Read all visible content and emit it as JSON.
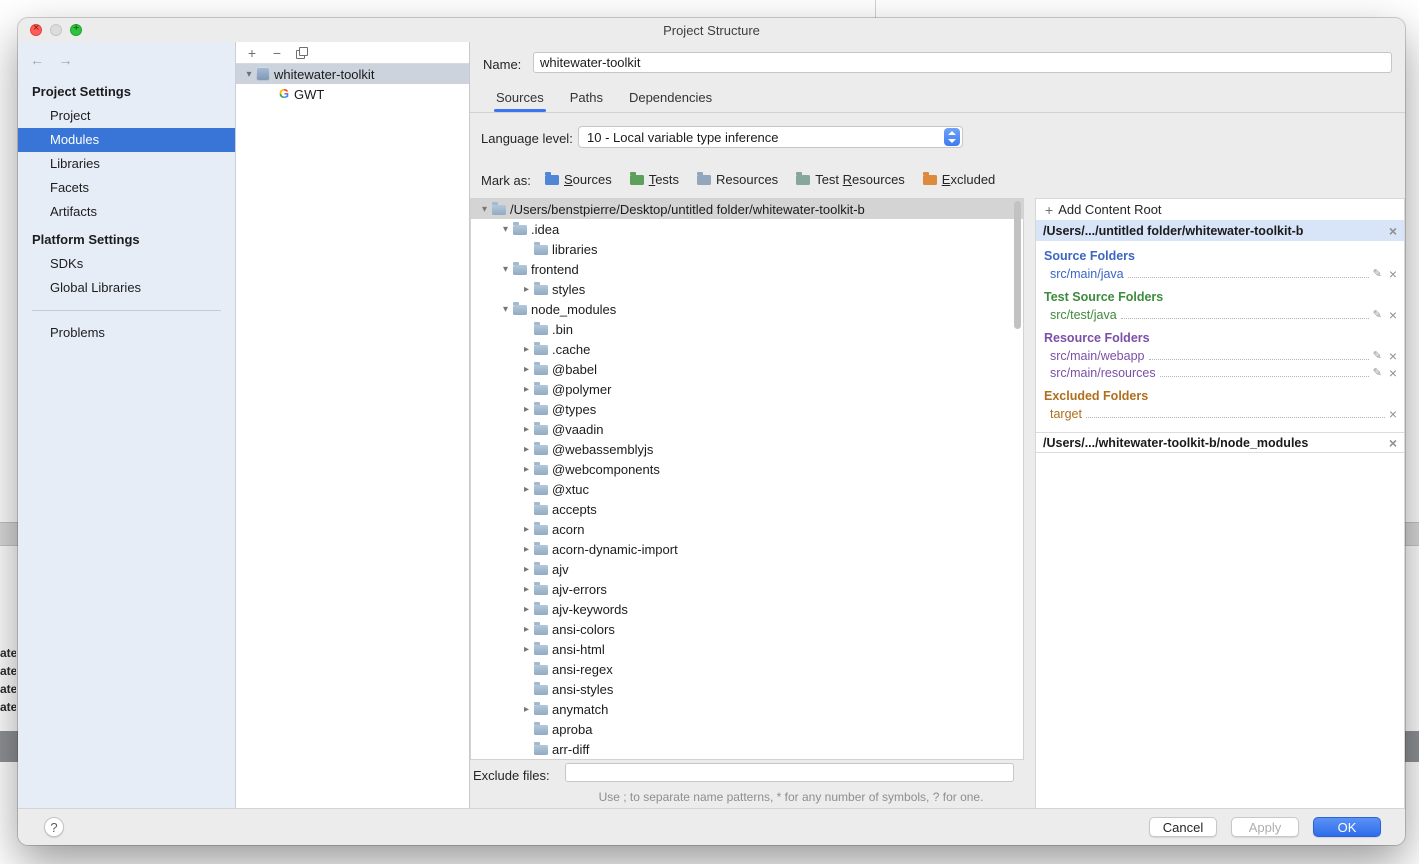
{
  "window": {
    "title": "Project Structure"
  },
  "background_fragments": [
    "ate",
    "ate",
    "ate",
    "ate"
  ],
  "colors": {
    "sidebar_selection": "#3875d7",
    "tab_accent": "#3b76f2",
    "ok_button": "#3b76f2"
  },
  "sidebar": {
    "groups": [
      {
        "header": "Project Settings",
        "items": [
          {
            "label": "Project",
            "selected": false
          },
          {
            "label": "Modules",
            "selected": true
          },
          {
            "label": "Libraries",
            "selected": false
          },
          {
            "label": "Facets",
            "selected": false
          },
          {
            "label": "Artifacts",
            "selected": false
          }
        ]
      },
      {
        "header": "Platform Settings",
        "items": [
          {
            "label": "SDKs",
            "selected": false
          },
          {
            "label": "Global Libraries",
            "selected": false
          }
        ]
      }
    ],
    "problems_label": "Problems"
  },
  "module_panel": {
    "module_name": "whitewater-toolkit",
    "facet_name": "GWT"
  },
  "main": {
    "name_label": "Name:",
    "name_value": "whitewater-toolkit",
    "tabs": [
      {
        "label": "Sources",
        "selected": true
      },
      {
        "label": "Paths",
        "selected": false
      },
      {
        "label": "Dependencies",
        "selected": false
      }
    ],
    "language_level_label": "Language level:",
    "language_level_value": "10 - Local variable type inference",
    "mark_as_label": "Mark as:",
    "mark_buttons": [
      {
        "label": "Sources",
        "underline": 0,
        "color": "#4f87d6"
      },
      {
        "label": "Tests",
        "underline": 0,
        "color": "#5ca05c"
      },
      {
        "label": "Resources",
        "underline": null,
        "color": "#93a7bc"
      },
      {
        "label": "Test Resources",
        "underline": 5,
        "color": "#86a79a"
      },
      {
        "label": "Excluded",
        "underline": 0,
        "color": "#de8a3e"
      }
    ],
    "exclude_label": "Exclude files:",
    "exclude_value": "",
    "exclude_hint": "Use ; to separate name patterns, * for any number of symbols, ? for one."
  },
  "file_tree": {
    "rows": [
      {
        "label": "/Users/benstpierre/Desktop/untitled folder/whitewater-toolkit-b",
        "level": 0,
        "expand": "open",
        "selected": true
      },
      {
        "label": ".idea",
        "level": 1,
        "expand": "open",
        "selected": false
      },
      {
        "label": "libraries",
        "level": 2,
        "expand": "none",
        "selected": false
      },
      {
        "label": "frontend",
        "level": 1,
        "expand": "open",
        "selected": false
      },
      {
        "label": "styles",
        "level": 2,
        "expand": "closed",
        "selected": false
      },
      {
        "label": "node_modules",
        "level": 1,
        "expand": "open",
        "selected": false
      },
      {
        "label": ".bin",
        "level": 2,
        "expand": "none",
        "selected": false
      },
      {
        "label": ".cache",
        "level": 2,
        "expand": "closed",
        "selected": false
      },
      {
        "label": "@babel",
        "level": 2,
        "expand": "closed",
        "selected": false
      },
      {
        "label": "@polymer",
        "level": 2,
        "expand": "closed",
        "selected": false
      },
      {
        "label": "@types",
        "level": 2,
        "expand": "closed",
        "selected": false
      },
      {
        "label": "@vaadin",
        "level": 2,
        "expand": "closed",
        "selected": false
      },
      {
        "label": "@webassemblyjs",
        "level": 2,
        "expand": "closed",
        "selected": false
      },
      {
        "label": "@webcomponents",
        "level": 2,
        "expand": "closed",
        "selected": false
      },
      {
        "label": "@xtuc",
        "level": 2,
        "expand": "closed",
        "selected": false
      },
      {
        "label": "accepts",
        "level": 2,
        "expand": "none",
        "selected": false
      },
      {
        "label": "acorn",
        "level": 2,
        "expand": "closed",
        "selected": false
      },
      {
        "label": "acorn-dynamic-import",
        "level": 2,
        "expand": "closed",
        "selected": false
      },
      {
        "label": "ajv",
        "level": 2,
        "expand": "closed",
        "selected": false
      },
      {
        "label": "ajv-errors",
        "level": 2,
        "expand": "closed",
        "selected": false
      },
      {
        "label": "ajv-keywords",
        "level": 2,
        "expand": "closed",
        "selected": false
      },
      {
        "label": "ansi-colors",
        "level": 2,
        "expand": "closed",
        "selected": false
      },
      {
        "label": "ansi-html",
        "level": 2,
        "expand": "closed",
        "selected": false
      },
      {
        "label": "ansi-regex",
        "level": 2,
        "expand": "none",
        "selected": false
      },
      {
        "label": "ansi-styles",
        "level": 2,
        "expand": "none",
        "selected": false
      },
      {
        "label": "anymatch",
        "level": 2,
        "expand": "closed",
        "selected": false
      },
      {
        "label": "aproba",
        "level": 2,
        "expand": "none",
        "selected": false
      },
      {
        "label": "arr-diff",
        "level": 2,
        "expand": "none",
        "selected": false
      }
    ]
  },
  "content_panel": {
    "add_content_root_label": "Add Content Root",
    "roots": [
      {
        "path": "/Users/.../untitled folder/whitewater-toolkit-b",
        "selected": true,
        "groups": [
          {
            "title": "Source Folders",
            "color": "#3c66c4",
            "items": [
              {
                "label": "src/main/java",
                "editable": true
              }
            ]
          },
          {
            "title": "Test Source Folders",
            "color": "#3d8b3d",
            "items": [
              {
                "label": "src/test/java",
                "editable": true
              }
            ]
          },
          {
            "title": "Resource Folders",
            "color": "#7b4fa6",
            "items": [
              {
                "label": "src/main/webapp",
                "editable": true
              },
              {
                "label": "src/main/resources",
                "editable": true
              }
            ]
          },
          {
            "title": "Excluded Folders",
            "color": "#b06f1e",
            "items": [
              {
                "label": "target",
                "editable": false
              }
            ]
          }
        ]
      },
      {
        "path": "/Users/.../whitewater-toolkit-b/node_modules",
        "selected": false,
        "groups": []
      }
    ]
  },
  "footer": {
    "help_label": "?",
    "cancel_label": "Cancel",
    "apply_label": "Apply",
    "ok_label": "OK"
  }
}
